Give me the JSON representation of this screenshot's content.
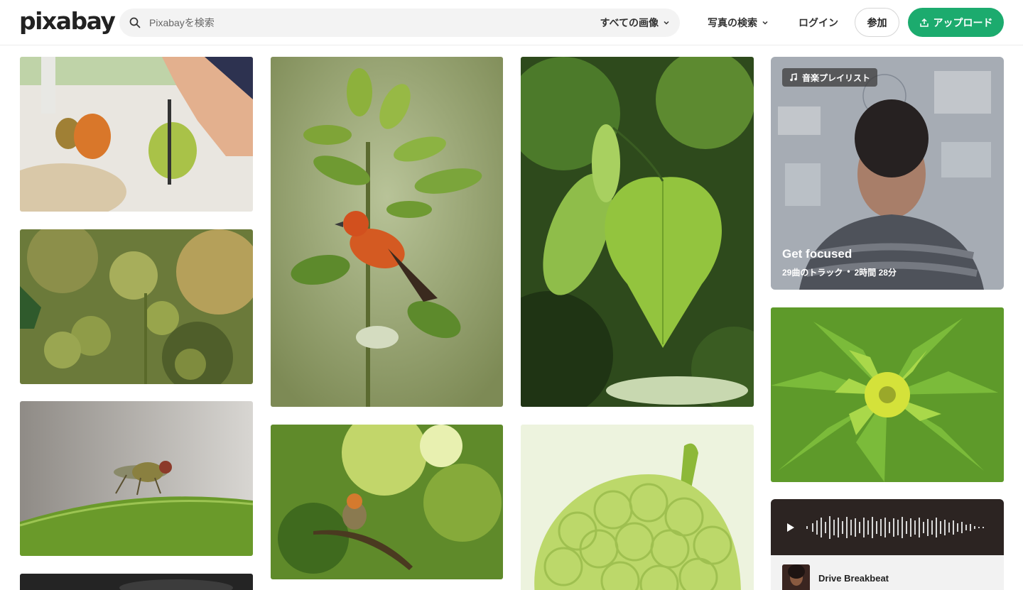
{
  "header": {
    "logo": "pixabay",
    "search_placeholder": "Pixabayを検索",
    "search_filter": "すべての画像",
    "explore_label": "写真の検索",
    "login_label": "ログイン",
    "join_label": "参加",
    "upload_label": "アップロード"
  },
  "playlist": {
    "tag": "音楽プレイリスト",
    "title": "Get focused",
    "tracks": "29曲のトラック",
    "separator": "•",
    "duration": "2時間 28分"
  },
  "audio": {
    "title": "Drive Breakbeat"
  },
  "colors": {
    "brand_green": "#1cab6e",
    "search_bg": "#f3f3f3"
  }
}
